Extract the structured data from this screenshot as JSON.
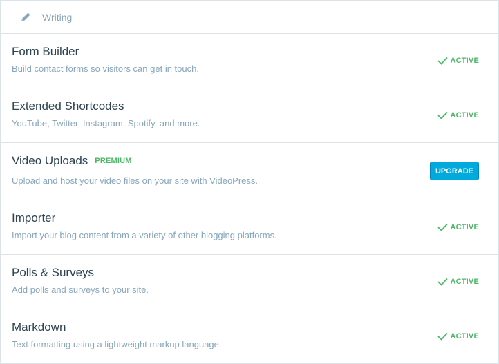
{
  "header": {
    "title": "Writing",
    "icon": "pencil-icon"
  },
  "modules": [
    {
      "name": "Form Builder",
      "description": "Build contact forms so visitors can get in touch.",
      "status": "ACTIVE"
    },
    {
      "name": "Extended Shortcodes",
      "description": "YouTube, Twitter, Instagram, Spotify, and more.",
      "status": "ACTIVE"
    },
    {
      "name": "Video Uploads",
      "badge": "PREMIUM",
      "description": "Upload and host your video files on your site with VideoPress.",
      "action": "UPGRADE"
    },
    {
      "name": "Importer",
      "description": "Import your blog content from a variety of other blogging platforms.",
      "status": "ACTIVE"
    },
    {
      "name": "Polls & Surveys",
      "description": "Add polls and surveys to your site.",
      "status": "ACTIVE"
    },
    {
      "name": "Markdown",
      "description": "Text formatting using a lightweight markup language.",
      "status": "ACTIVE"
    }
  ],
  "colors": {
    "active": "#4ab866",
    "upgrade": "#00aadc",
    "text": "#2e4453",
    "muted": "#87a6bc",
    "border": "#dbe3e9"
  }
}
